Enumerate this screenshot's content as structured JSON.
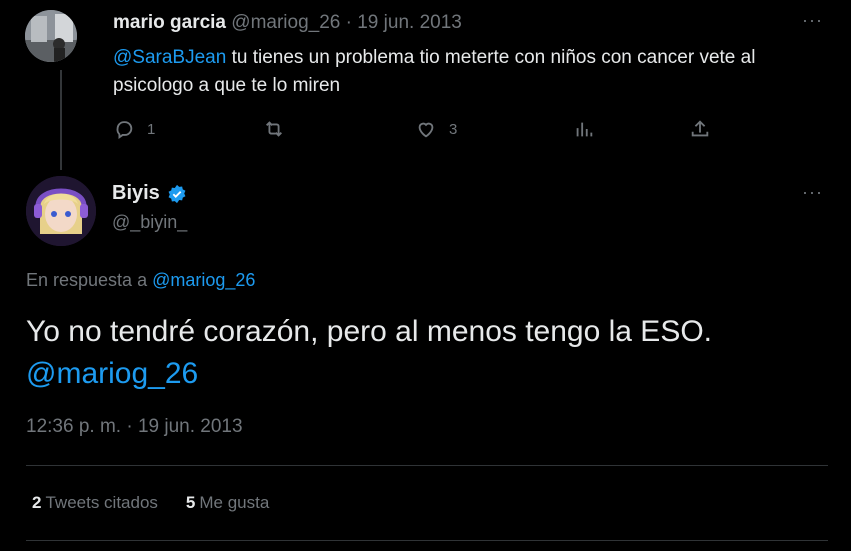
{
  "parent": {
    "name": "mario garcia",
    "handle": "@mariog_26",
    "date": " · 19 jun. 2013",
    "mention": "@SaraBJean",
    "text": " tu tienes un problema tio meterte con niños con cancer vete al psicologo a que te lo miren",
    "replies": "1",
    "retweets": "",
    "likes": "3",
    "more": "···"
  },
  "tweet": {
    "name": "Biyis",
    "handle": "@_biyin_",
    "more": "···",
    "reply_prefix": "En respuesta a ",
    "reply_handle": "@mariog_26",
    "text": "Yo no tendré corazón, pero al menos tengo la ESO.",
    "mention": "@mariog_26",
    "timestamp": "12:36 p. m. · 19 jun. 2013"
  },
  "stats": {
    "quotes_count": "2",
    "quotes_label": "Tweets citados",
    "likes_count": "5",
    "likes_label": "Me gusta"
  },
  "colors": {
    "accent": "#1d9bf0",
    "background": "#000000",
    "muted": "#71767b",
    "text": "#e7e9ea"
  }
}
